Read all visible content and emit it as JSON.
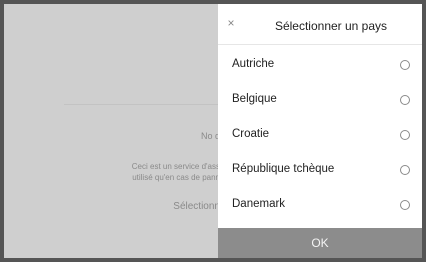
{
  "background": {
    "no_data_text": "No d",
    "description_line1": "Ceci est un service d'ass",
    "description_line2": "utilisé qu'en cas de pann",
    "select_text": "Sélectionn"
  },
  "modal": {
    "close_icon": "close-icon",
    "close_glyph": "×",
    "title": "Sélectionner un pays",
    "countries": [
      {
        "label": "Autriche",
        "selected": false
      },
      {
        "label": "Belgique",
        "selected": false
      },
      {
        "label": "Croatie",
        "selected": false
      },
      {
        "label": "République tchèque",
        "selected": false
      },
      {
        "label": "Danemark",
        "selected": false
      }
    ],
    "ok_label": "OK"
  },
  "colors": {
    "overlay": "#cfcfcf",
    "panel": "#ffffff",
    "ok_button": "#8c8c8c"
  }
}
